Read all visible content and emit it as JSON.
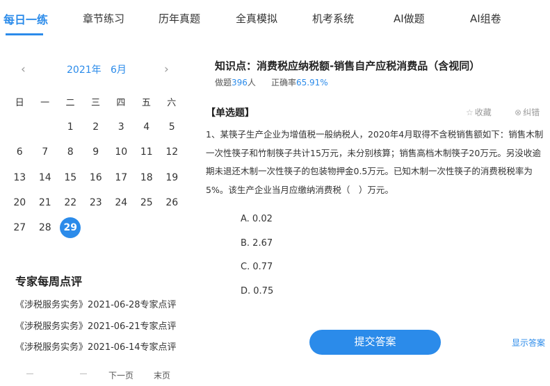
{
  "nav": {
    "tabs": [
      {
        "label": "每日一练",
        "active": true
      },
      {
        "label": "章节练习"
      },
      {
        "label": "历年真题"
      },
      {
        "label": "全真模拟"
      },
      {
        "label": "机考系统"
      },
      {
        "label": "AI做题"
      },
      {
        "label": "AI组卷"
      }
    ]
  },
  "calendar": {
    "prev_icon": "‹",
    "next_icon": "›",
    "year": "2021年",
    "month": "6月",
    "weekdays": [
      "日",
      "一",
      "二",
      "三",
      "四",
      "五",
      "六"
    ],
    "days": [
      "",
      "",
      "1",
      "2",
      "3",
      "4",
      "5",
      "6",
      "7",
      "8",
      "9",
      "10",
      "11",
      "12",
      "13",
      "14",
      "15",
      "16",
      "17",
      "18",
      "19",
      "20",
      "21",
      "22",
      "23",
      "24",
      "25",
      "26",
      "27",
      "28",
      "29"
    ],
    "selected_day": "29"
  },
  "review": {
    "title": "专家每周点评",
    "items": [
      "《涉税服务实务》2021-06-28专家点评",
      "《涉税服务实务》2021-06-21专家点评",
      "《涉税服务实务》2021-06-14专家点评"
    ],
    "pager": {
      "next": "下一页",
      "last": "末页"
    }
  },
  "question": {
    "knowledge_point": "知识点：消费税应纳税额-销售自产应税消费品（含视同）",
    "stats": {
      "attempts_label": "做题",
      "attempts_value": "396",
      "attempts_unit": "人",
      "accuracy_label": "正确率",
      "accuracy_value": "65.91%"
    },
    "type": "【单选题】",
    "actions": {
      "favorite": "收藏",
      "favorite_icon": "☆",
      "report": "纠错",
      "report_icon": "⊗"
    },
    "text": "1、某筷子生产企业为增值税一般纳税人，2020年4月取得不含税销售额如下：销售木制一次性筷子和竹制筷子共计15万元，未分别核算；销售高档木制筷子20万元。另没收逾期未退还木制一次性筷子的包装物押金0.5万元。已知木制一次性筷子的消费税税率为5%。该生产企业当月应缴纳消费税（　）万元。",
    "options": [
      "A. 0.02",
      "B. 2.67",
      "C. 0.77",
      "D. 0.75"
    ],
    "submit_label": "提交答案",
    "show_answer_label": "显示答案"
  },
  "colors": {
    "accent": "#2b8bea",
    "text": "#333333",
    "muted": "#999999"
  }
}
